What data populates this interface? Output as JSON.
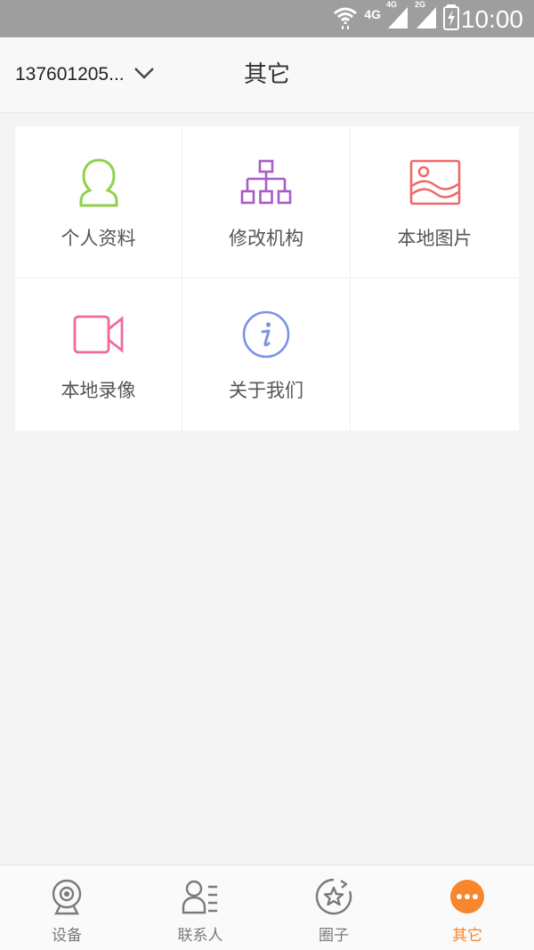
{
  "status_bar": {
    "network_4g": "4G",
    "signal1_tag": "4G",
    "signal2_tag": "2G",
    "time": "10:00"
  },
  "header": {
    "account": "137601205...",
    "title": "其它"
  },
  "grid": {
    "items": [
      {
        "label": "个人资料",
        "icon": "profile-icon",
        "color": "#8fd14f"
      },
      {
        "label": "修改机构",
        "icon": "org-chart-icon",
        "color": "#a85cc9"
      },
      {
        "label": "本地图片",
        "icon": "picture-icon",
        "color": "#f0696a"
      },
      {
        "label": "本地录像",
        "icon": "video-camera-icon",
        "color": "#f06aa0"
      },
      {
        "label": "关于我们",
        "icon": "info-icon",
        "color": "#7b93e6"
      }
    ]
  },
  "bottom_nav": {
    "items": [
      {
        "label": "设备",
        "icon": "webcam-icon"
      },
      {
        "label": "联系人",
        "icon": "contacts-icon"
      },
      {
        "label": "圈子",
        "icon": "circle-star-icon"
      },
      {
        "label": "其它",
        "icon": "more-icon",
        "active": true
      }
    ],
    "active_color": "#f7862c",
    "inactive_color": "#7a7a7a"
  }
}
